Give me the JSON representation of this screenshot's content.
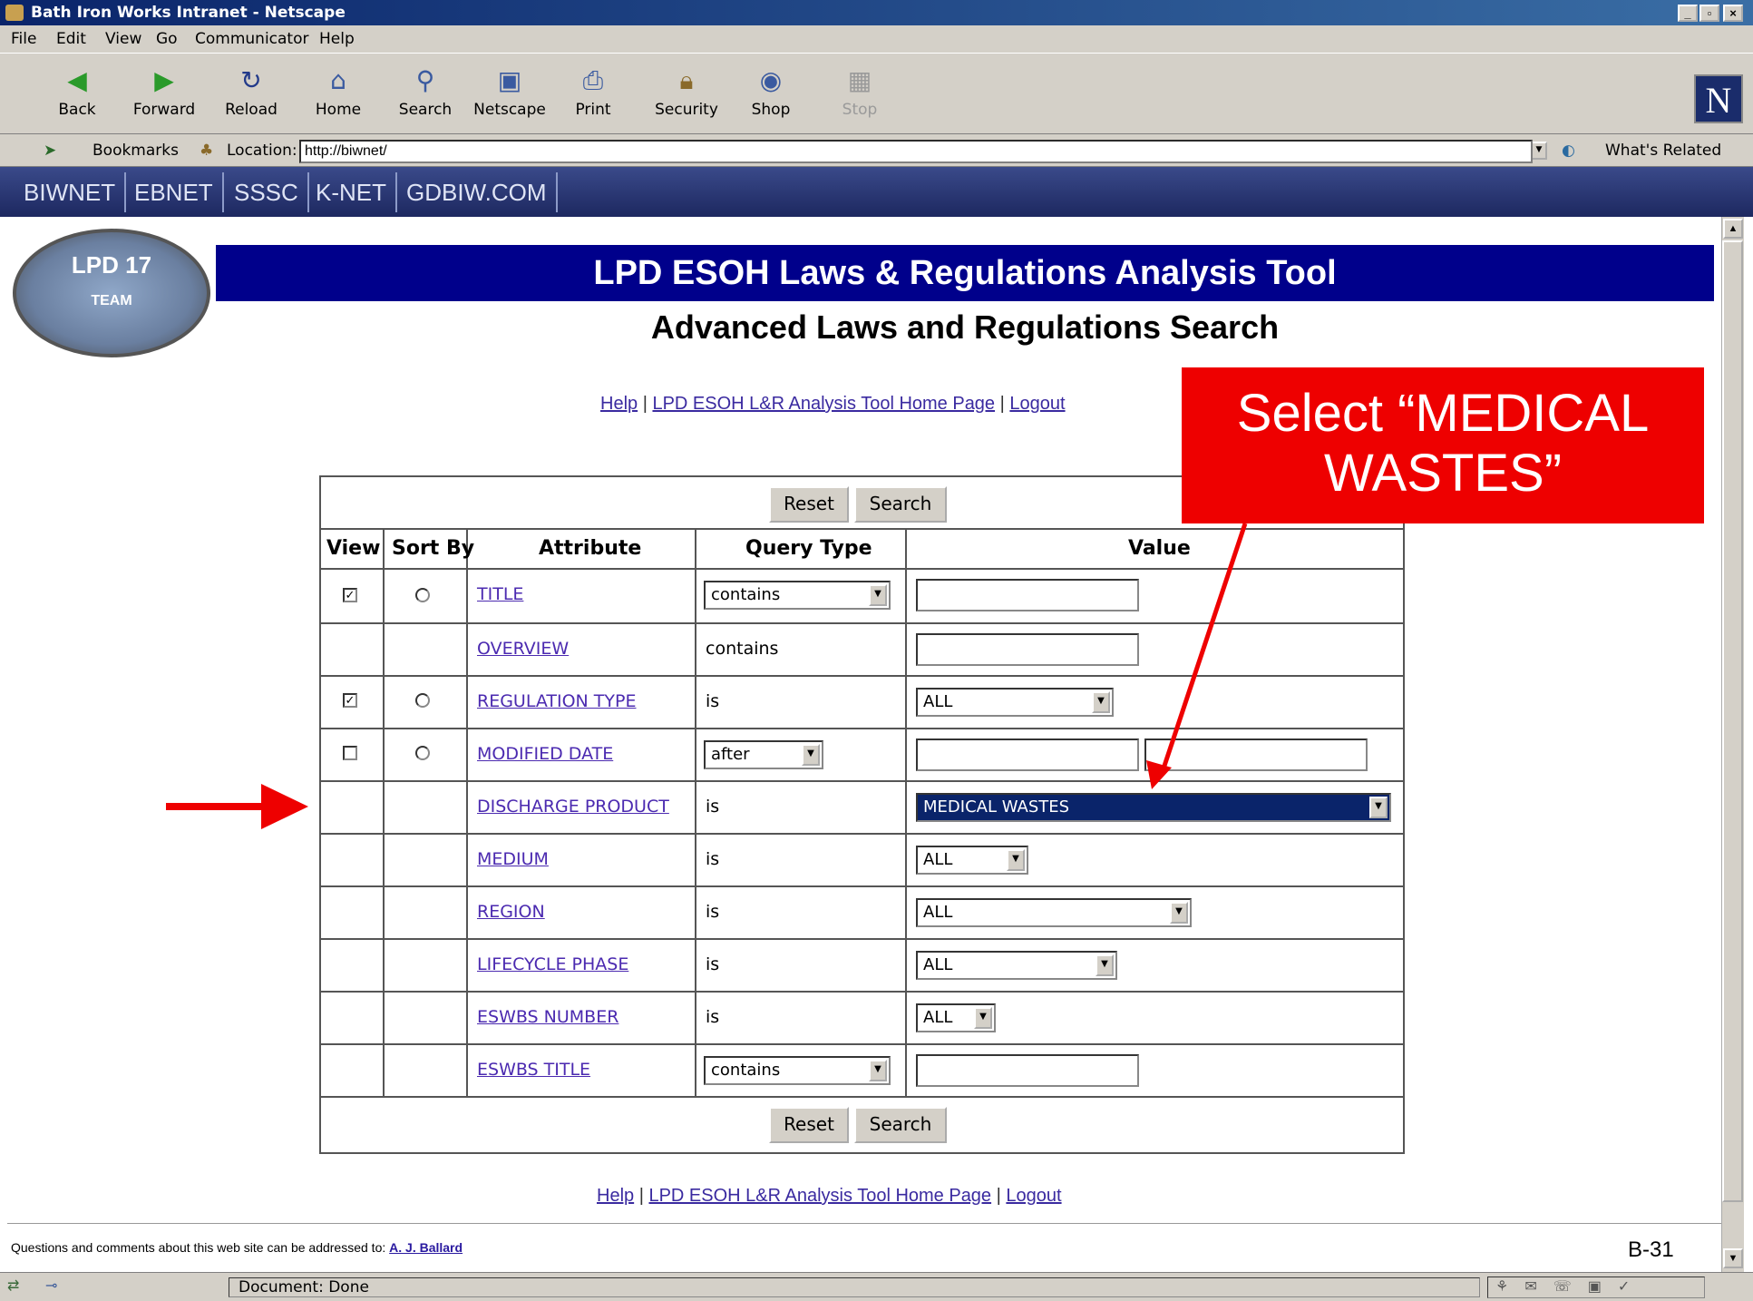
{
  "window": {
    "title": "Bath Iron Works Intranet - Netscape"
  },
  "menu": [
    "File",
    "Edit",
    "View",
    "Go",
    "Communicator",
    "Help"
  ],
  "toolbar": [
    {
      "label": "Back",
      "icon": "back-arrow-icon"
    },
    {
      "label": "Forward",
      "icon": "forward-arrow-icon"
    },
    {
      "label": "Reload",
      "icon": "reload-icon"
    },
    {
      "label": "Home",
      "icon": "home-icon"
    },
    {
      "label": "Search",
      "icon": "search-icon"
    },
    {
      "label": "Netscape",
      "icon": "netscape-icon"
    },
    {
      "label": "Print",
      "icon": "print-icon"
    },
    {
      "label": "Security",
      "icon": "security-icon"
    },
    {
      "label": "Shop",
      "icon": "shop-icon"
    },
    {
      "label": "Stop",
      "icon": "stop-icon"
    }
  ],
  "location": {
    "bookmarks": "Bookmarks",
    "label": "Location:",
    "url": "http://biwnet/",
    "related": "What's Related"
  },
  "nav_tabs": [
    "BIWNET",
    "EBNET",
    "SSSC",
    "K-NET",
    "GDBIW.COM"
  ],
  "page": {
    "logo_text": "LPD 17",
    "logo_sub": "TEAM",
    "banner": "LPD ESOH Laws & Regulations Analysis Tool",
    "subtitle": "Advanced Laws and Regulations Search",
    "links": {
      "help": "Help",
      "home": "LPD ESOH L&R Analysis Tool Home Page",
      "logout": "Logout",
      "sep": "|"
    }
  },
  "table": {
    "reset": "Reset",
    "search": "Search",
    "headers": {
      "view": "View",
      "sort": "Sort By",
      "attr": "Attribute",
      "qtype": "Query Type",
      "value": "Value"
    },
    "rows": [
      {
        "attr": "TITLE",
        "qtype": "contains",
        "value": ""
      },
      {
        "attr": "OVERVIEW",
        "qtype": "contains",
        "value": ""
      },
      {
        "attr": "REGULATION TYPE",
        "qtype": "is",
        "value": "ALL"
      },
      {
        "attr": "MODIFIED DATE",
        "qtype": "after",
        "value": ""
      },
      {
        "attr": "DISCHARGE PRODUCT",
        "qtype": "is",
        "value": "MEDICAL WASTES"
      },
      {
        "attr": "MEDIUM",
        "qtype": "is",
        "value": "ALL"
      },
      {
        "attr": "REGION",
        "qtype": "is",
        "value": "ALL"
      },
      {
        "attr": "LIFECYCLE PHASE",
        "qtype": "is",
        "value": "ALL"
      },
      {
        "attr": "ESWBS NUMBER",
        "qtype": "is",
        "value": "ALL"
      },
      {
        "attr": "ESWBS TITLE",
        "qtype": "contains",
        "value": ""
      }
    ]
  },
  "callout": {
    "text": "Select “MEDICAL WASTES”"
  },
  "footer": {
    "text": "Questions and comments about this web site can be addressed to:",
    "contact": "A. J. Ballard",
    "page_num": "B-31"
  },
  "status": {
    "text": "Document: Done"
  },
  "colors": {
    "banner": "#00008b",
    "callout": "#ee0000",
    "navbar": "#1d2860",
    "titlebar": "#0a246a"
  }
}
